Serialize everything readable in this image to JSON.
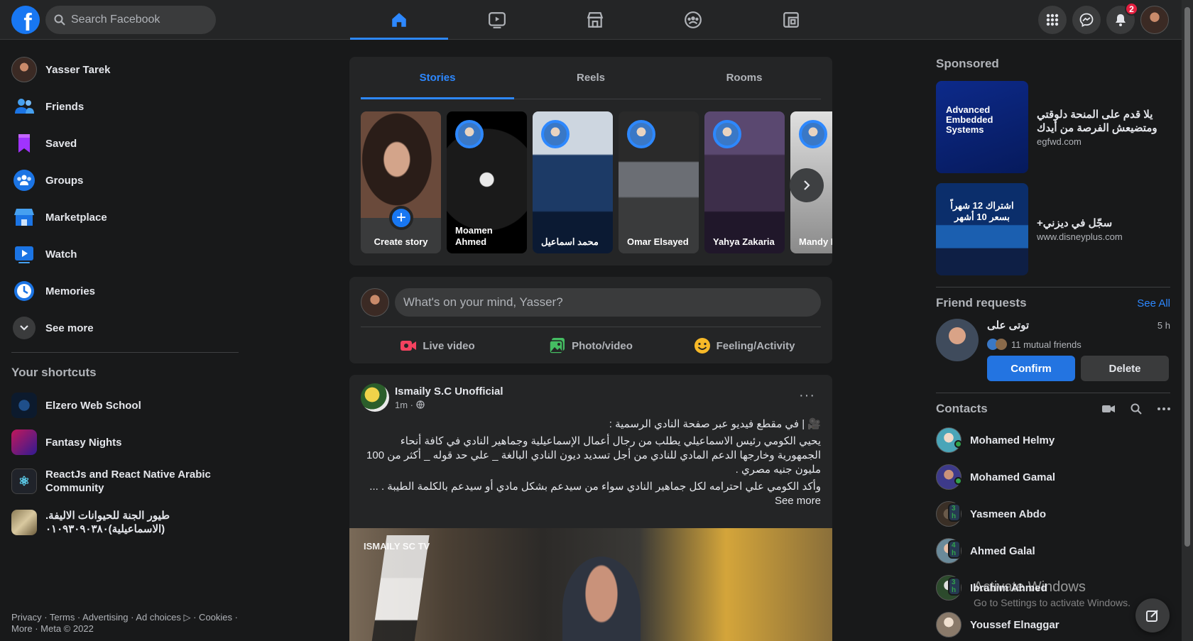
{
  "topbar": {
    "logo_letter": "f",
    "search_placeholder": "Search Facebook",
    "notifications_count": "2",
    "nav_icons": [
      "home-icon",
      "watch-icon",
      "marketplace-icon",
      "groups-icon",
      "gaming-icon"
    ],
    "active_nav": "home"
  },
  "left": {
    "items": [
      {
        "label": "Yasser Tarek",
        "icon": "profile-avatar"
      },
      {
        "label": "Friends",
        "icon": "friends-icon"
      },
      {
        "label": "Saved",
        "icon": "saved-icon"
      },
      {
        "label": "Groups",
        "icon": "groups-icon"
      },
      {
        "label": "Marketplace",
        "icon": "marketplace-icon"
      },
      {
        "label": "Watch",
        "icon": "watch-icon"
      },
      {
        "label": "Memories",
        "icon": "memories-icon"
      },
      {
        "label": "See more",
        "icon": "chevron-down-icon"
      }
    ],
    "shortcuts_title": "Your shortcuts",
    "shortcuts": [
      {
        "label": "Elzero Web School"
      },
      {
        "label": "Fantasy Nights"
      },
      {
        "label": "ReactJs and React Native Arabic Community"
      },
      {
        "label": "طيور الجنة للحيوانات الاليفة. (الاسماعيلية)٠١٠٩٣٠٩٠٣٨٠"
      }
    ],
    "footer": "Privacy · Terms · Advertising · Ad choices ▷ · Cookies · More · Meta © 2022"
  },
  "stories": {
    "tabs": [
      "Stories",
      "Reels",
      "Rooms"
    ],
    "active_tab": "Stories",
    "create_label": "Create story",
    "items": [
      {
        "name": "Moamen Ahmed"
      },
      {
        "name": "محمد اسماعيل"
      },
      {
        "name": "Omar Elsayed"
      },
      {
        "name": "Yahya Zakaria"
      },
      {
        "name": "Mandy M"
      }
    ]
  },
  "composer": {
    "placeholder": "What's on your mind, Yasser?",
    "actions": [
      {
        "label": "Live video",
        "icon": "live-video-icon",
        "color": "#f3425f"
      },
      {
        "label": "Photo/video",
        "icon": "photo-icon",
        "color": "#45bd62"
      },
      {
        "label": "Feeling/Activity",
        "icon": "feeling-icon",
        "color": "#f7b928"
      }
    ]
  },
  "post": {
    "author": "Ismaily S.C Unofficial",
    "time": "1m ·",
    "more": "···",
    "line1": "🎥 | في مقطع فيديو عبر صفحة النادي الرسمية :",
    "line2": "يحيي الكومي رئيس الاسماعيلي يطلب من  رجال أعمال الإسماعيلية وجماهير النادي في كافة أنحاء الجمهورية وخارجها الدعم المادي للنادي من أجل تسديد ديون النادي البالغة _ علي حد قوله _ أكثر من 100 مليون جنيه مصري .",
    "line3": "وأكد الكومي علي احترامه لكل جماهير النادي سواء من سيدعم بشكل مادي أو سيدعم بالكلمة الطيبة . ... See more",
    "image_watermark": "ISMAILY SC TV"
  },
  "right": {
    "sponsored_title": "Sponsored",
    "ads": [
      {
        "title": "يلا قدم على المنحة دلوقتي ومتضيعش الفرصة من أيدك",
        "url": "egfwd.com",
        "image_text": "Advanced Embedded Systems"
      },
      {
        "title": "سجّل في ديزني+",
        "url": "www.disneyplus.com",
        "image_text": "اشتراك 12 شهراً بسعر 10 أشهر"
      }
    ],
    "friend_requests_title": "Friend requests",
    "see_all": "See All",
    "request": {
      "name": "توتى على",
      "mutual": "11 mutual friends",
      "time": "5 h",
      "confirm": "Confirm",
      "delete": "Delete"
    },
    "contacts_title": "Contacts",
    "contacts": [
      {
        "name": "Mohamed Helmy",
        "status": "online",
        "chip": ""
      },
      {
        "name": "Mohamed Gamal",
        "status": "online",
        "chip": ""
      },
      {
        "name": "Yasmeen Abdo",
        "status": "away",
        "chip": "3 h"
      },
      {
        "name": "Ahmed Galal",
        "status": "away",
        "chip": "4 h"
      },
      {
        "name": "Ibrahim Ahmed",
        "status": "away",
        "chip": "3 h"
      },
      {
        "name": "Youssef Elnaggar",
        "status": "offline",
        "chip": ""
      }
    ]
  },
  "watermark": {
    "title": "Activate Windows",
    "subtitle": "Go to Settings to activate Windows."
  },
  "colors": {
    "accent": "#2d88ff",
    "background": "#18191a",
    "surface": "#242526"
  }
}
